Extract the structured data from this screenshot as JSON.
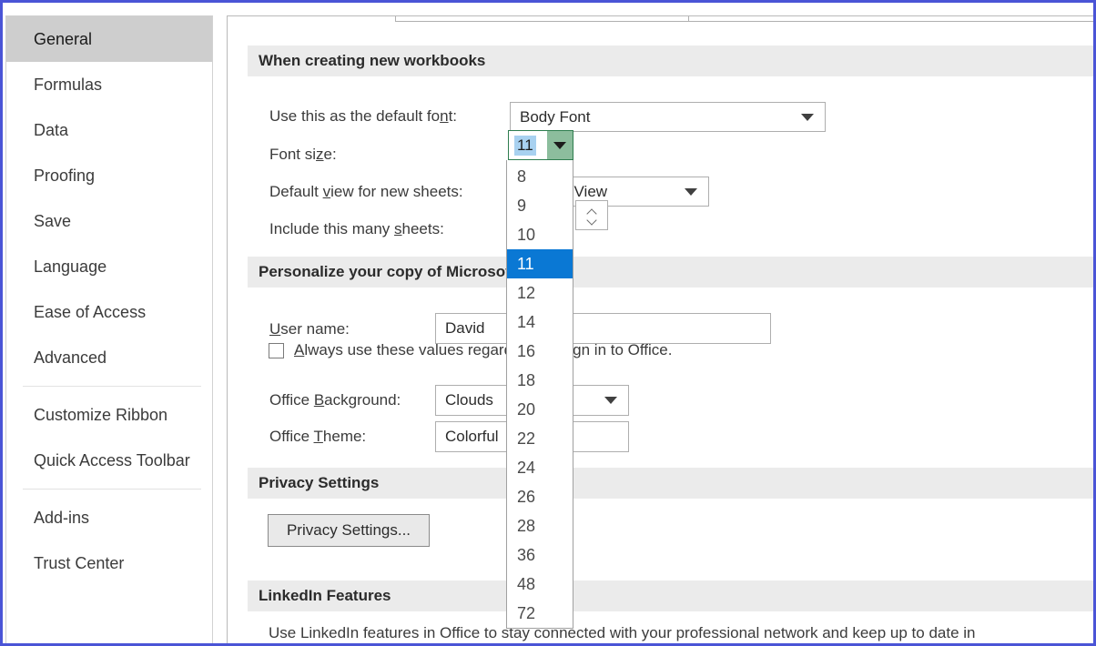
{
  "sidebar": {
    "items": [
      {
        "label": "General",
        "selected": true,
        "sep_after": false
      },
      {
        "label": "Formulas",
        "selected": false,
        "sep_after": false
      },
      {
        "label": "Data",
        "selected": false,
        "sep_after": false
      },
      {
        "label": "Proofing",
        "selected": false,
        "sep_after": false
      },
      {
        "label": "Save",
        "selected": false,
        "sep_after": false
      },
      {
        "label": "Language",
        "selected": false,
        "sep_after": false
      },
      {
        "label": "Ease of Access",
        "selected": false,
        "sep_after": false
      },
      {
        "label": "Advanced",
        "selected": false,
        "sep_after": true
      },
      {
        "label": "Customize Ribbon",
        "selected": false,
        "sep_after": false
      },
      {
        "label": "Quick Access Toolbar",
        "selected": false,
        "sep_after": true
      },
      {
        "label": "Add-ins",
        "selected": false,
        "sep_after": false
      },
      {
        "label": "Trust Center",
        "selected": false,
        "sep_after": false
      }
    ]
  },
  "sections": {
    "workbooks_header": "When creating new workbooks",
    "personalize_header": "Personalize your copy of Microsoft Office",
    "privacy_header": "Privacy Settings",
    "linkedin_header": "LinkedIn Features"
  },
  "workbooks": {
    "default_font_label_a": "Use this as the default fo",
    "default_font_label_u": "n",
    "default_font_label_b": "t:",
    "default_font_value": "Body Font",
    "font_size_label_a": "Font si",
    "font_size_label_u": "z",
    "font_size_label_b": "e:",
    "font_size_value": "11",
    "default_view_label_a": "Default ",
    "default_view_label_u": "v",
    "default_view_label_b": "iew for new sheets:",
    "default_view_value": "Normal View",
    "include_sheets_label_a": "Include this many ",
    "include_sheets_label_u": "s",
    "include_sheets_label_b": "heets:"
  },
  "font_size_options": [
    "8",
    "9",
    "10",
    "11",
    "12",
    "14",
    "16",
    "18",
    "20",
    "22",
    "24",
    "26",
    "28",
    "36",
    "48",
    "72"
  ],
  "font_size_selected": "11",
  "personalize": {
    "user_name_label_u": "U",
    "user_name_label_b": "ser name:",
    "user_name_value": "David",
    "always_use_label_a": "A",
    "always_use_label_b": "lways use these values regardless of sign in to Office.",
    "always_use_checked": false,
    "office_background_label_a": "Office ",
    "office_background_label_u": "B",
    "office_background_label_b": "ackground:",
    "office_background_value": "Clouds",
    "office_theme_label_a": "Office ",
    "office_theme_label_u": "T",
    "office_theme_label_b": "heme:",
    "office_theme_value": "Colorful"
  },
  "privacy": {
    "button_label": "Privacy Settings..."
  },
  "linkedin": {
    "description": "Use LinkedIn features in Office to stay connected with your professional network and keep up to date in"
  },
  "colors": {
    "frame": "#4a54d6",
    "sidebar_selected": "#cecece",
    "section_header_bg": "#ebebeb",
    "combo_focus_border": "#2e7d4f",
    "combo_drop_bg": "#8cbd9d",
    "value_highlight": "#a8d1f0",
    "list_selected_bg": "#0a78d4"
  }
}
